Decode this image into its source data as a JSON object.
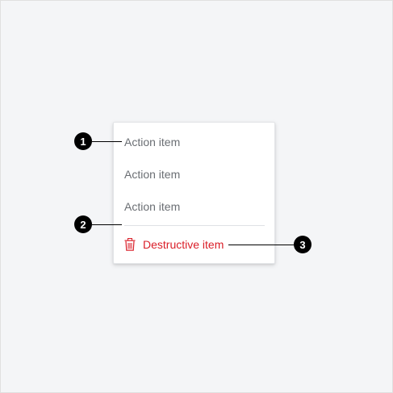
{
  "menu": {
    "items": [
      {
        "label": "Action item"
      },
      {
        "label": "Action item"
      },
      {
        "label": "Action item"
      }
    ],
    "destructive": {
      "label": "Destructive item",
      "icon": "trash-icon",
      "color": "#da1e28"
    }
  },
  "callouts": [
    {
      "number": "1"
    },
    {
      "number": "2"
    },
    {
      "number": "3"
    }
  ],
  "colors": {
    "background": "#f4f5f7",
    "item_text": "#6a6e73",
    "marker": "#000000"
  }
}
